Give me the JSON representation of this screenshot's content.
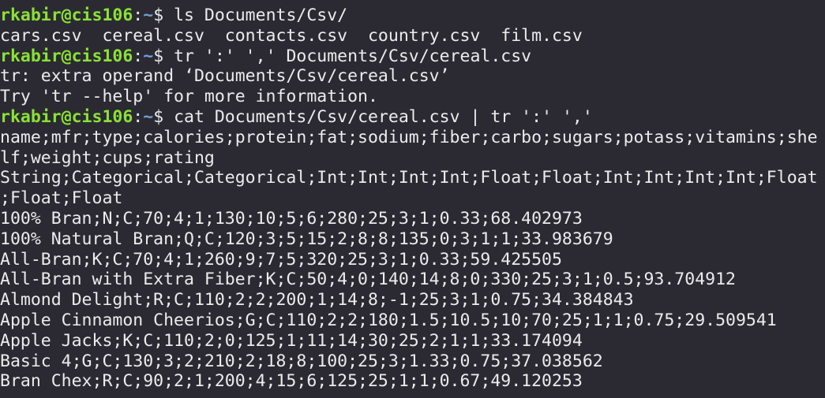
{
  "prompt": {
    "user_host": "rkabir@cis106",
    "colon": ":",
    "path": "~",
    "symbol": "$ "
  },
  "colors": {
    "background": "#2b2a33",
    "text": "#ececec",
    "user_host": "#8ae234",
    "path": "#729fcf"
  },
  "lines": [
    {
      "type": "prompt",
      "command": "ls Documents/Csv/"
    },
    {
      "type": "output",
      "text": "cars.csv  cereal.csv  contacts.csv  country.csv  film.csv"
    },
    {
      "type": "prompt",
      "command": "tr ':' ',' Documents/Csv/cereal.csv"
    },
    {
      "type": "output",
      "text": "tr: extra operand ‘Documents/Csv/cereal.csv’"
    },
    {
      "type": "output",
      "text": "Try 'tr --help' for more information."
    },
    {
      "type": "prompt",
      "command": "cat Documents/Csv/cereal.csv | tr ':' ','"
    },
    {
      "type": "output",
      "text": "name;mfr;type;calories;protein;fat;sodium;fiber;carbo;sugars;potass;vitamins;she"
    },
    {
      "type": "output",
      "text": "lf;weight;cups;rating"
    },
    {
      "type": "output",
      "text": "String;Categorical;Categorical;Int;Int;Int;Int;Float;Float;Int;Int;Int;Int;Float"
    },
    {
      "type": "output",
      "text": ";Float;Float"
    },
    {
      "type": "output",
      "text": "100% Bran;N;C;70;4;1;130;10;5;6;280;25;3;1;0.33;68.402973"
    },
    {
      "type": "output",
      "text": "100% Natural Bran;Q;C;120;3;5;15;2;8;8;135;0;3;1;1;33.983679"
    },
    {
      "type": "output",
      "text": "All-Bran;K;C;70;4;1;260;9;7;5;320;25;3;1;0.33;59.425505"
    },
    {
      "type": "output",
      "text": "All-Bran with Extra Fiber;K;C;50;4;0;140;14;8;0;330;25;3;1;0.5;93.704912"
    },
    {
      "type": "output",
      "text": "Almond Delight;R;C;110;2;2;200;1;14;8;-1;25;3;1;0.75;34.384843"
    },
    {
      "type": "output",
      "text": "Apple Cinnamon Cheerios;G;C;110;2;2;180;1.5;10.5;10;70;25;1;1;0.75;29.509541"
    },
    {
      "type": "output",
      "text": "Apple Jacks;K;C;110;2;0;125;1;11;14;30;25;2;1;1;33.174094"
    },
    {
      "type": "output",
      "text": "Basic 4;G;C;130;3;2;210;2;18;8;100;25;3;1.33;0.75;37.038562"
    },
    {
      "type": "output",
      "text": "Bran Chex;R;C;90;2;1;200;4;15;6;125;25;1;1;0.67;49.120253"
    }
  ]
}
